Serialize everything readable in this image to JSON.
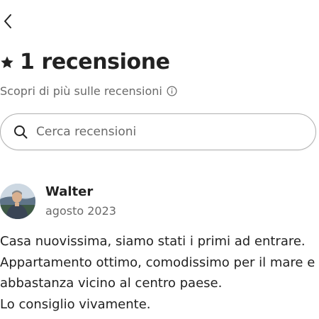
{
  "header": {
    "back_icon": "chevron-left-icon",
    "star_icon": "star-icon",
    "title": "1 recensione",
    "subtitle": "Scopri di più sulle recensioni",
    "info_icon": "info-icon"
  },
  "search": {
    "icon": "search-icon",
    "placeholder": "Cerca recensioni"
  },
  "reviews": [
    {
      "author": "Walter",
      "date": "agosto 2023",
      "avatar_icon": "avatar-photo",
      "text_lines": [
        "Casa nuovissima, siamo stati i primi ad entrare.",
        "Appartamento ottimo, comodissimo per il mare e",
        "abbastanza vicino al centro paese.",
        "Lo consiglio vivamente."
      ]
    }
  ]
}
